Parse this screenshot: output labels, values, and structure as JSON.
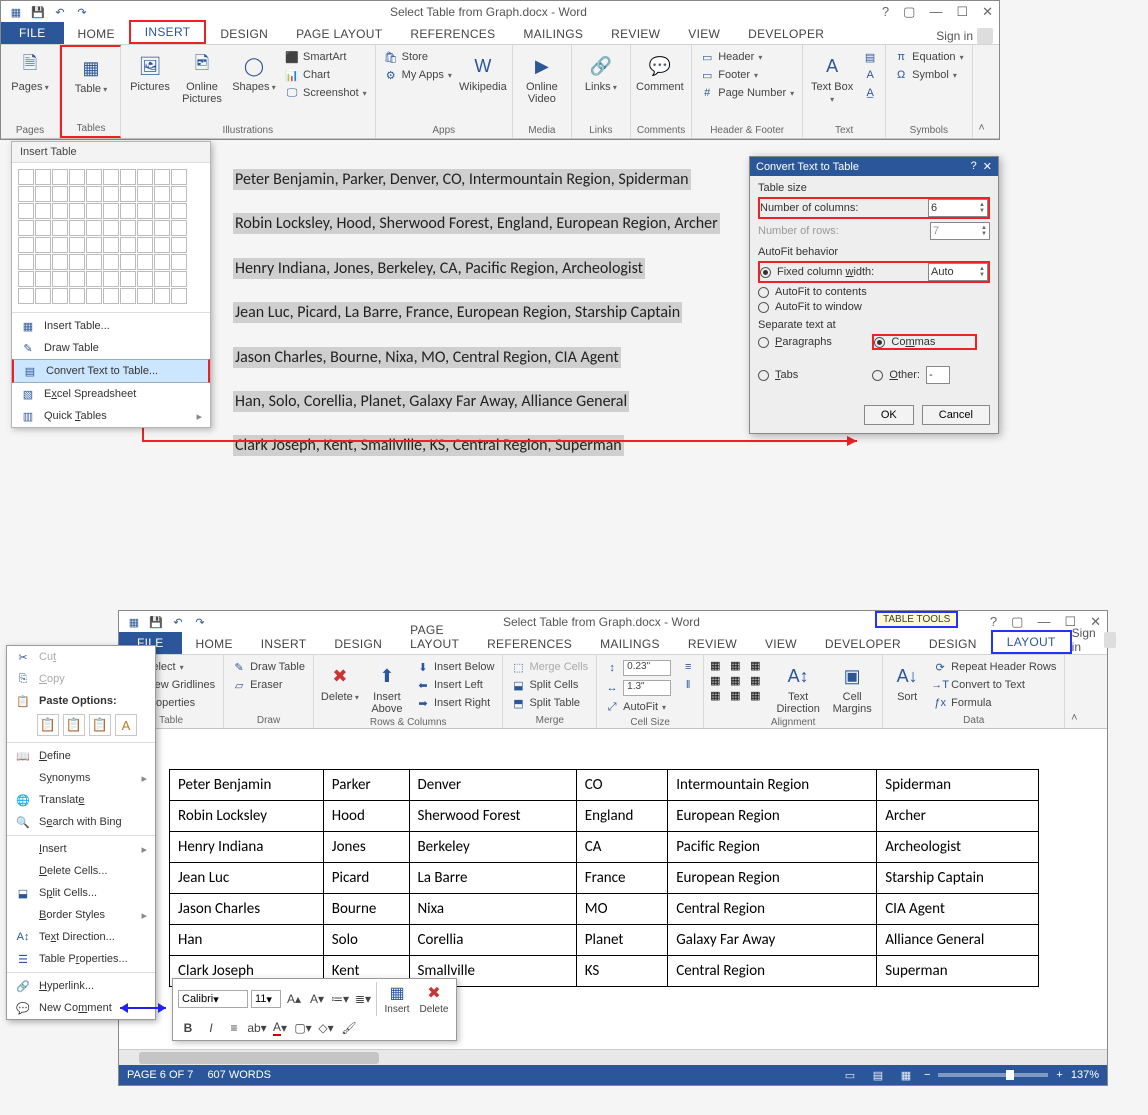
{
  "top": {
    "title": "Select Table from Graph.docx - Word",
    "tabs": [
      "FILE",
      "HOME",
      "INSERT",
      "DESIGN",
      "PAGE LAYOUT",
      "REFERENCES",
      "MAILINGS",
      "REVIEW",
      "VIEW",
      "DEVELOPER"
    ],
    "signin": "Sign in",
    "groups": {
      "pages": "Pages",
      "tables": "Tables",
      "illus": "Illustrations",
      "apps": "Apps",
      "media": "Media",
      "links": "Links",
      "comments": "Comments",
      "hf": "Header & Footer",
      "text": "Text",
      "symbols": "Symbols"
    },
    "btn": {
      "pages": "Pages",
      "table": "Table",
      "pictures": "Pictures",
      "online_pics": "Online Pictures",
      "shapes": "Shapes",
      "smartart": "SmartArt",
      "chart": "Chart",
      "screenshot": "Screenshot",
      "store": "Store",
      "myapps": "My Apps",
      "wikipedia": "Wikipedia",
      "online_video": "Online Video",
      "links_lbl": "Links",
      "comment": "Comment",
      "header": "Header",
      "footer": "Footer",
      "pagenum": "Page Number",
      "textbox": "Text Box",
      "equation": "Equation",
      "symbol": "Symbol"
    }
  },
  "table_dd": {
    "title": "Insert Table",
    "items": {
      "insert": "Insert Table...",
      "draw": "Draw Table",
      "convert": "Convert Text to Table...",
      "excel": "Excel Spreadsheet",
      "quick": "Quick Tables"
    }
  },
  "doclines": [
    "Peter Benjamin, Parker, Denver, CO, Intermountain Region, Spiderman",
    "Robin Locksley, Hood, Sherwood Forest, England, European Region, Archer",
    "Henry Indiana, Jones, Berkeley, CA, Pacific Region, Archeologist",
    "Jean Luc, Picard, La Barre, France, European Region, Starship Captain",
    "Jason Charles, Bourne, Nixa, MO, Central Region, CIA Agent",
    "Han, Solo, Corellia, Planet, Galaxy Far Away, Alliance General",
    "Clark Joseph, Kent, Smallville, KS, Central Region, Superman"
  ],
  "dlg": {
    "title": "Convert Text to Table",
    "tablesize": "Table size",
    "ncols_lbl": "Number of columns:",
    "ncols": "6",
    "nrows_lbl": "Number of rows:",
    "nrows": "7",
    "autofit": "AutoFit behavior",
    "fixed": "Fixed column width:",
    "fixed_val": "Auto",
    "fit_contents": "AutoFit to contents",
    "fit_window": "AutoFit to window",
    "sep": "Separate text at",
    "paragraphs": "Paragraphs",
    "commas": "Commas",
    "tabs": "Tabs",
    "other": "Other:",
    "other_val": "-",
    "ok": "OK",
    "cancel": "Cancel"
  },
  "bottom": {
    "title": "Select Table from Graph.docx - Word",
    "table_tools": "TABLE TOOLS",
    "tabs": [
      "FILE",
      "HOME",
      "INSERT",
      "DESIGN",
      "PAGE LAYOUT",
      "REFERENCES",
      "MAILINGS",
      "REVIEW",
      "VIEW",
      "DEVELOPER",
      "DESIGN",
      "LAYOUT"
    ],
    "signin": "Sign in",
    "groups": {
      "table": "Table",
      "draw": "Draw",
      "rowscols": "Rows & Columns",
      "merge": "Merge",
      "cellsize": "Cell Size",
      "align": "Alignment",
      "data": "Data"
    },
    "btn": {
      "select": "Select",
      "viewgrid": "View Gridlines",
      "props": "Properties",
      "draw": "Draw Table",
      "eraser": "Eraser",
      "delete": "Delete",
      "ins_above": "Insert Above",
      "ins_below": "Insert Below",
      "ins_left": "Insert Left",
      "ins_right": "Insert Right",
      "merge": "Merge Cells",
      "split_cells": "Split Cells",
      "split_table": "Split Table",
      "height": "0.23\"",
      "width": "1.3\"",
      "autofit": "AutoFit",
      "textdir": "Text Direction",
      "cellmargin": "Cell Margins",
      "sort": "Sort",
      "repeathdr": "Repeat Header Rows",
      "convtext": "Convert to Text",
      "formula": "Formula"
    }
  },
  "resrows": [
    [
      "Peter Benjamin",
      "Parker",
      "Denver",
      "CO",
      "Intermountain Region",
      "Spiderman"
    ],
    [
      "Robin Locksley",
      "Hood",
      "Sherwood Forest",
      "England",
      "European Region",
      "Archer"
    ],
    [
      "Henry Indiana",
      "Jones",
      "Berkeley",
      "CA",
      "Pacific Region",
      "Archeologist"
    ],
    [
      "Jean Luc",
      "Picard",
      "La Barre",
      "France",
      "European Region",
      "Starship Captain"
    ],
    [
      "Jason Charles",
      "Bourne",
      "Nixa",
      "MO",
      "Central Region",
      "CIA Agent"
    ],
    [
      "Han",
      "Solo",
      "Corellia",
      "Planet",
      "Galaxy Far Away",
      "Alliance General"
    ],
    [
      "Clark Joseph",
      "Kent",
      "Smallville",
      "KS",
      "Central Region",
      "Superman"
    ]
  ],
  "ctx": {
    "cut": "Cut",
    "copy": "Copy",
    "paste_hdr": "Paste Options:",
    "define": "Define",
    "synonyms": "Synonyms",
    "translate": "Translate",
    "search_bing": "Search with Bing",
    "insert": "Insert",
    "delete_cells": "Delete Cells...",
    "split_cells": "Split Cells...",
    "border_styles": "Border Styles",
    "text_dir": "Text Direction...",
    "table_props": "Table Properties...",
    "hyperlink": "Hyperlink...",
    "new_comment": "New Comment"
  },
  "mini": {
    "font": "Calibri",
    "size": "11",
    "insert": "Insert",
    "delete": "Delete"
  },
  "status": {
    "page": "PAGE 6 OF 7",
    "words": "607 WORDS",
    "zoom": "137%"
  }
}
